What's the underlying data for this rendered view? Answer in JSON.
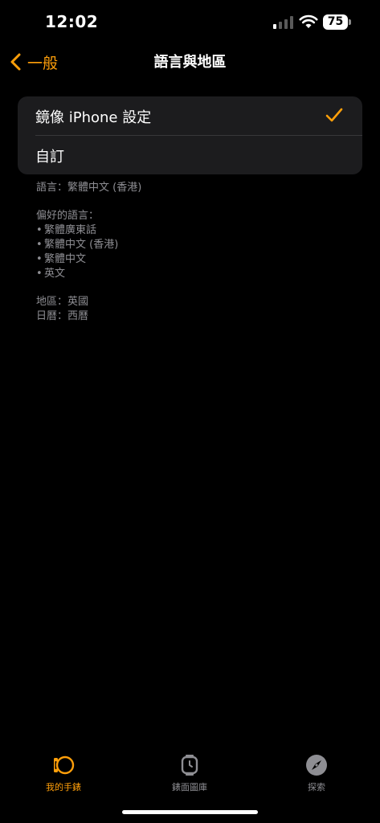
{
  "status_bar": {
    "time": "12:02",
    "battery": "75"
  },
  "nav": {
    "back_label": "一般",
    "title": "語言與地區"
  },
  "options": [
    {
      "label": "鏡像 iPhone 設定",
      "selected": true
    },
    {
      "label": "自訂",
      "selected": false
    }
  ],
  "info": {
    "language_line": "語言：繁體中文 (香港)",
    "preferred_header": "偏好的語言：",
    "preferred": [
      "繁體廣東話",
      "繁體中文 (香港)",
      "繁體中文",
      "英文"
    ],
    "region_line": "地區：英國",
    "calendar_line": "日曆：西曆"
  },
  "tabs": [
    {
      "label": "我的手錶",
      "active": true
    },
    {
      "label": "錶面圖庫",
      "active": false
    },
    {
      "label": "探索",
      "active": false
    }
  ],
  "colors": {
    "accent": "#ff9f0a",
    "background": "#000000",
    "card": "#1c1c1e",
    "secondary_text": "#8e8e93"
  }
}
